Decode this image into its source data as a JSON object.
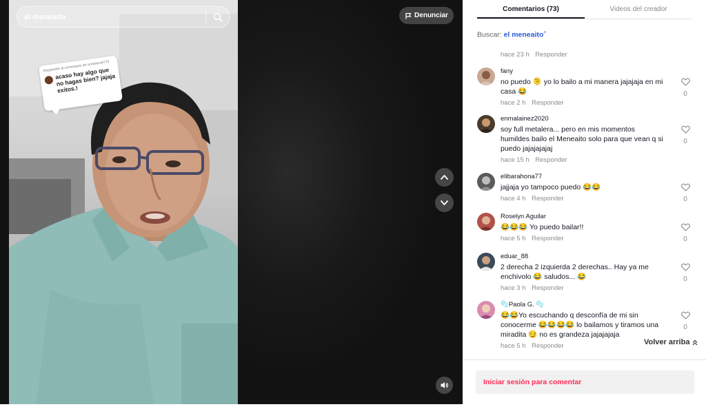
{
  "video": {
    "search_text": "el meneaito",
    "report_label": "Denunciar",
    "reply_sticker": {
      "header": "Responder al comentario de sombrero0770",
      "text": "acaso hay algo que no hagas bien? jajaja exitos.!"
    }
  },
  "panel": {
    "tabs": [
      {
        "label": "Comentarios (73)",
        "active": true
      },
      {
        "label": "Videos del creador",
        "active": false
      }
    ],
    "search_prefix": "Buscar:",
    "search_term": "el meneaito",
    "first_meta": {
      "time": "hace 23 h",
      "reply": "Responder"
    },
    "comments": [
      {
        "user": "fany",
        "text": "no puedo 🫠 yo lo bailo a mi manera jajajaja en mi casa 😂",
        "time": "hace 2 h",
        "reply": "Responder",
        "likes": "0"
      },
      {
        "user": "enmalainez2020",
        "text": "soy full metalera... pero en mis momentos humildes bailo el Meneaito solo para que vean q si puedo jajajajajaj",
        "time": "hace 15 h",
        "reply": "Responder",
        "likes": "0"
      },
      {
        "user": "elibarahona77",
        "text": "jajjaja yo tampoco puedo 😂😂",
        "time": "hace 4 h",
        "reply": "Responder",
        "likes": "0"
      },
      {
        "user": "Roselyn Aguilar",
        "text": "😂😂😂 Yo puedo bailar!!",
        "time": "hace 5 h",
        "reply": "Responder",
        "likes": "0"
      },
      {
        "user": "eduar_88",
        "text": "2 derecha 2 izquierda 2 derechas.. Hay ya me enchivolo 😂 saludos... 😂",
        "time": "hace 3 h",
        "reply": "Responder",
        "likes": "0"
      },
      {
        "user": "🫧Paola G. 🫧",
        "text": "😂😂Yo escuchando q desconfía de mi sin conocerme 😂😂😂😂 lo bailamos y tiramos una miradita 😏 no es grandeza jajajajaja",
        "time": "hace 5 h",
        "reply": "Responder",
        "likes": "0"
      }
    ],
    "scroll_top_label": "Volver arriba",
    "login_prompt": "Iniciar sesión para comentar"
  },
  "colors": {
    "accent": "#fe2c55",
    "link": "#2b5cd8",
    "text": "#161823",
    "muted": "#8a8a8a"
  },
  "icons": [
    "search-icon",
    "flag-icon",
    "chevron-up-icon",
    "chevron-down-icon",
    "volume-icon",
    "heart-icon",
    "double-chevron-up-icon"
  ]
}
